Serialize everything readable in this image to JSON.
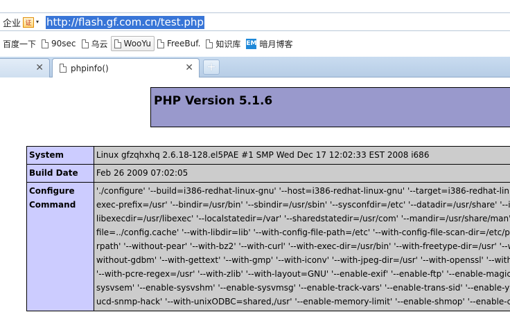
{
  "browser": {
    "address_bar": {
      "mode_label": "企业",
      "cert_badge": "证",
      "dropdown_glyph": "▾",
      "url": "http://flash.gf.com.cn/test.php"
    },
    "bookmarks": [
      {
        "label": "百度一下",
        "icon": "none",
        "active": false
      },
      {
        "label": "90sec",
        "icon": "doc-icon",
        "active": false
      },
      {
        "label": "乌云",
        "icon": "doc-icon",
        "active": false
      },
      {
        "label": "WooYu",
        "icon": "doc-icon",
        "active": true
      },
      {
        "label": "FreeBuf.",
        "icon": "doc-icon",
        "active": false
      },
      {
        "label": "知识库",
        "icon": "doc-icon",
        "active": false
      },
      {
        "label": "暗月博客",
        "icon": "em-icon",
        "active": false
      }
    ],
    "em_icon_text": "EM",
    "tabs": [
      {
        "title": "",
        "close": "✕"
      },
      {
        "title": "phpinfo()",
        "close": "✕"
      }
    ],
    "new_tab_glyph": "+"
  },
  "page": {
    "php_version": "PHP Version 5.1.6",
    "rows": [
      {
        "key": "System",
        "value": "Linux gfzqhxhq 2.6.18-128.el5PAE #1 SMP Wed Dec 17 12:02:33 EST 2008 i686"
      },
      {
        "key": "Build Date",
        "value": "Feb 26 2009 07:02:05"
      },
      {
        "key": "Configure Command",
        "key_lines": [
          "Configure",
          "Command"
        ],
        "value_lines": [
          "'./configure' '--build=i386-redhat-linux-gnu' '--host=i386-redhat-linux-gnu' '--target=i386-redhat-linux-",
          "exec-prefix=/usr' '--bindir=/usr/bin' '--sbindir=/usr/sbin' '--sysconfdir=/etc' '--datadir=/usr/share' '--in",
          "libexecdir=/usr/libexec' '--localstatedir=/var' '--sharedstatedir=/usr/com' '--mandir=/usr/share/man' '-",
          "file=../config.cache' '--with-libdir=lib' '--with-config-file-path=/etc' '--with-config-file-scan-dir=/etc/php",
          "rpath' '--without-pear' '--with-bz2' '--with-curl' '--with-exec-dir=/usr/bin' '--with-freetype-dir=/usr' '--w",
          "without-gdbm' '--with-gettext' '--with-gmp' '--with-iconv' '--with-jpeg-dir=/usr' '--with-openssl' '--with",
          "'--with-pcre-regex=/usr' '--with-zlib' '--with-layout=GNU' '--enable-exif' '--enable-ftp' '--enable-magic-",
          "sysvsem' '--enable-sysvshm' '--enable-sysvmsg' '--enable-track-vars' '--enable-trans-sid' '--enable-yp'",
          "ucd-snmp-hack' '--with-unixODBC=shared,/usr' '--enable-memory-limit' '--enable-shmop' '--enable-cal"
        ]
      }
    ]
  },
  "colors": {
    "header_bg": "#9999cc",
    "key_cell_bg": "#ccccff",
    "value_cell_bg": "#cccccc",
    "url_selection": "#3875d7"
  }
}
